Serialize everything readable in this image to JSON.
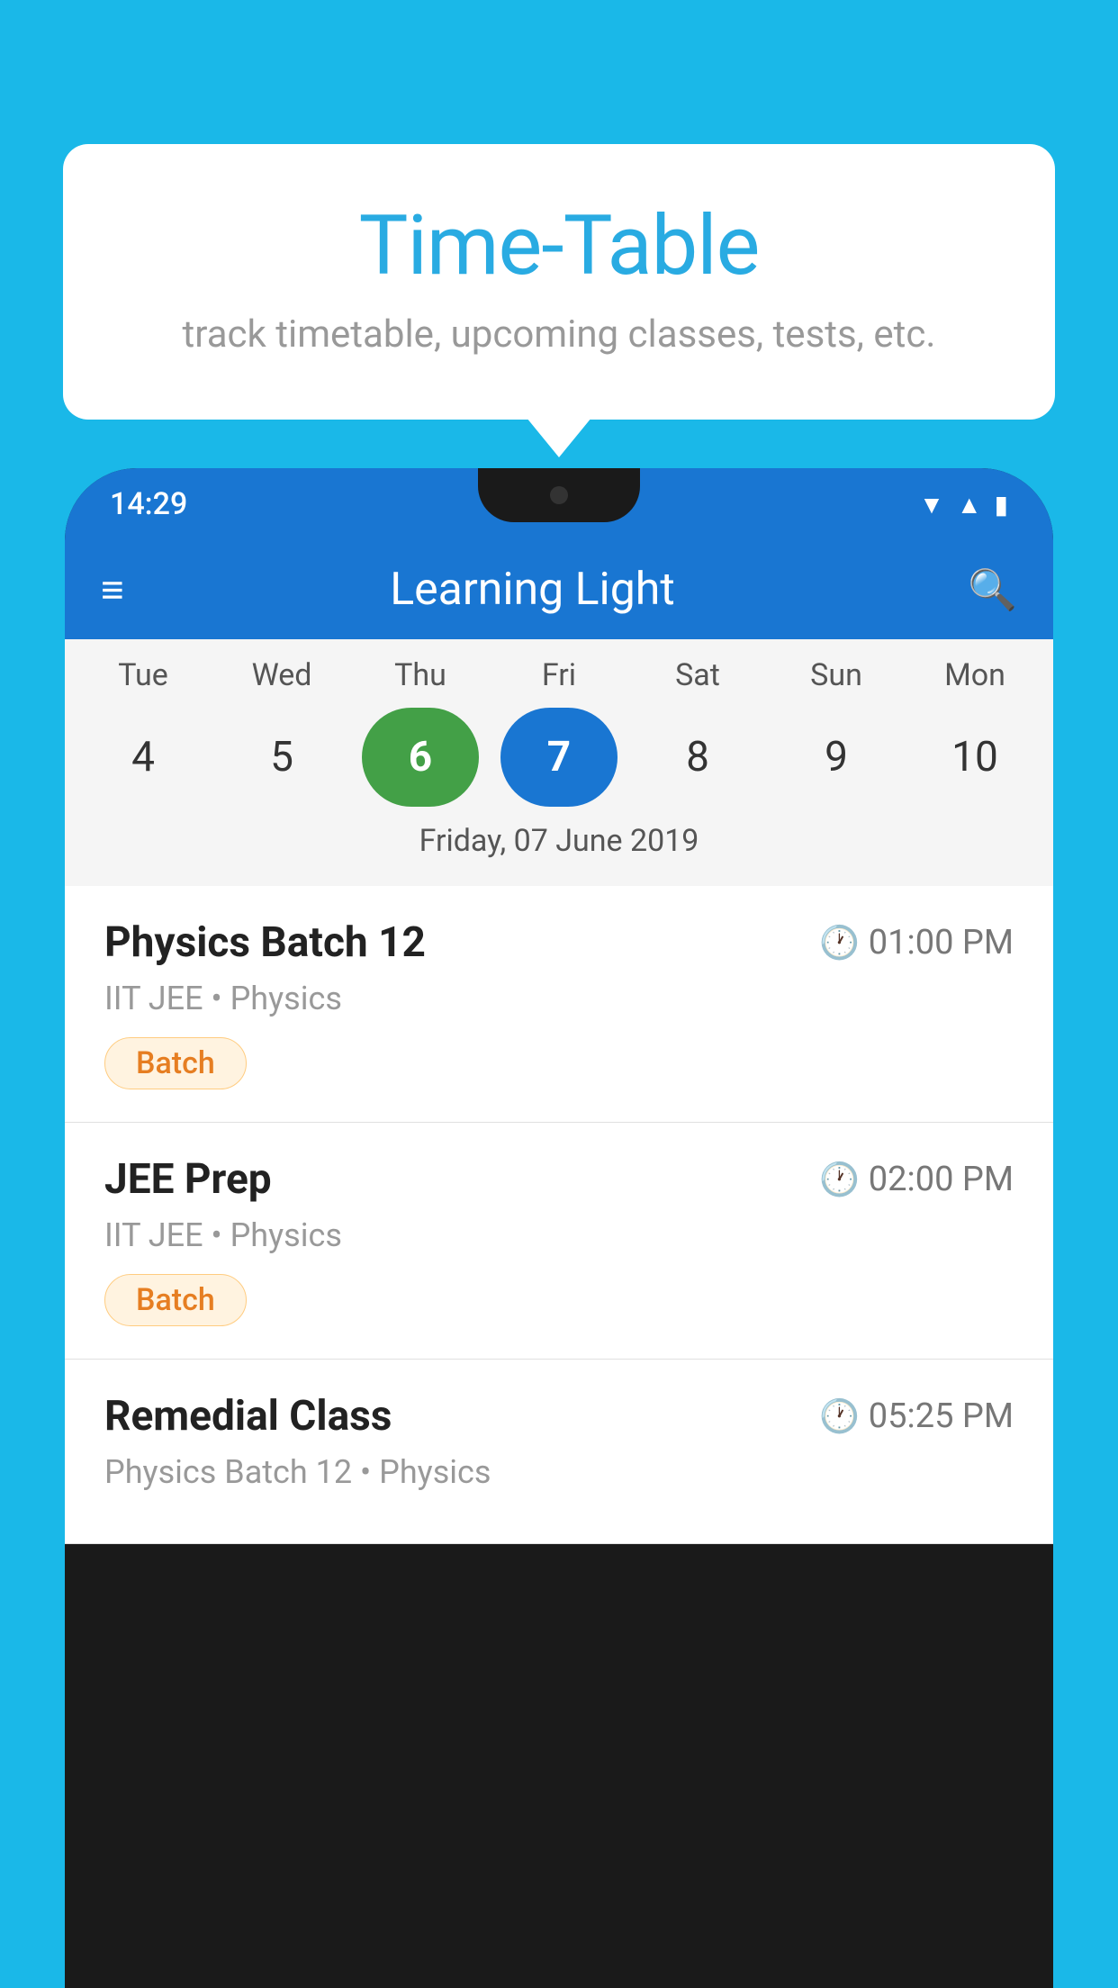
{
  "background_color": "#1ab8e8",
  "bubble": {
    "title": "Time-Table",
    "subtitle": "track timetable, upcoming classes, tests, etc."
  },
  "app": {
    "status_time": "14:29",
    "title": "Learning Light",
    "menu_icon": "≡",
    "search_icon": "🔍"
  },
  "calendar": {
    "days": [
      {
        "label": "Tue",
        "num": "4"
      },
      {
        "label": "Wed",
        "num": "5"
      },
      {
        "label": "Thu",
        "num": "6",
        "state": "today"
      },
      {
        "label": "Fri",
        "num": "7",
        "state": "selected"
      },
      {
        "label": "Sat",
        "num": "8"
      },
      {
        "label": "Sun",
        "num": "9"
      },
      {
        "label": "Mon",
        "num": "10"
      }
    ],
    "selected_date_label": "Friday, 07 June 2019"
  },
  "schedule": {
    "items": [
      {
        "title": "Physics Batch 12",
        "time": "01:00 PM",
        "subtitle": "IIT JEE • Physics",
        "tag": "Batch"
      },
      {
        "title": "JEE Prep",
        "time": "02:00 PM",
        "subtitle": "IIT JEE • Physics",
        "tag": "Batch"
      },
      {
        "title": "Remedial Class",
        "time": "05:25 PM",
        "subtitle": "Physics Batch 12 • Physics",
        "tag": ""
      }
    ]
  }
}
